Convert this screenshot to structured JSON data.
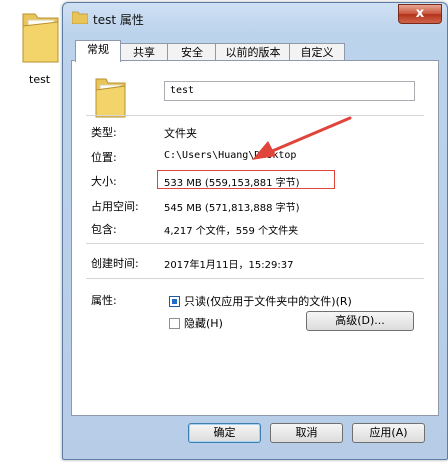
{
  "desktop": {
    "folder_label": "test"
  },
  "window": {
    "title": "test 属性",
    "close_glyph": "x"
  },
  "tabs": [
    {
      "label": "常规"
    },
    {
      "label": "共享"
    },
    {
      "label": "安全"
    },
    {
      "label": "以前的版本"
    },
    {
      "label": "自定义"
    }
  ],
  "general": {
    "name_value": "test",
    "type_label": "类型:",
    "type_value": "文件夹",
    "location_label": "位置:",
    "location_value": "C:\\Users\\Huang\\Desktop",
    "size_label": "大小:",
    "size_value": "533 MB (559,153,881 字节)",
    "disk_size_label": "占用空间:",
    "disk_size_value": "545 MB (571,813,888 字节)",
    "contains_label": "包含:",
    "contains_value": "4,217 个文件，559 个文件夹",
    "created_label": "创建时间:",
    "created_value": "2017年1月11日，15:29:37",
    "attributes_label": "属性:",
    "readonly_label": "只读(仅应用于文件夹中的文件)(R)",
    "readonly_checked": true,
    "hidden_label": "隐藏(H)",
    "hidden_checked": false,
    "advanced_button": "高级(D)..."
  },
  "footer": {
    "ok_button": "确定",
    "cancel_button": "取消",
    "apply_button": "应用(A)"
  },
  "colors": {
    "annotation_red": "#e0443a",
    "title_bar": "#bcd3ec",
    "checkbox_blue": "#1f6fc4"
  }
}
